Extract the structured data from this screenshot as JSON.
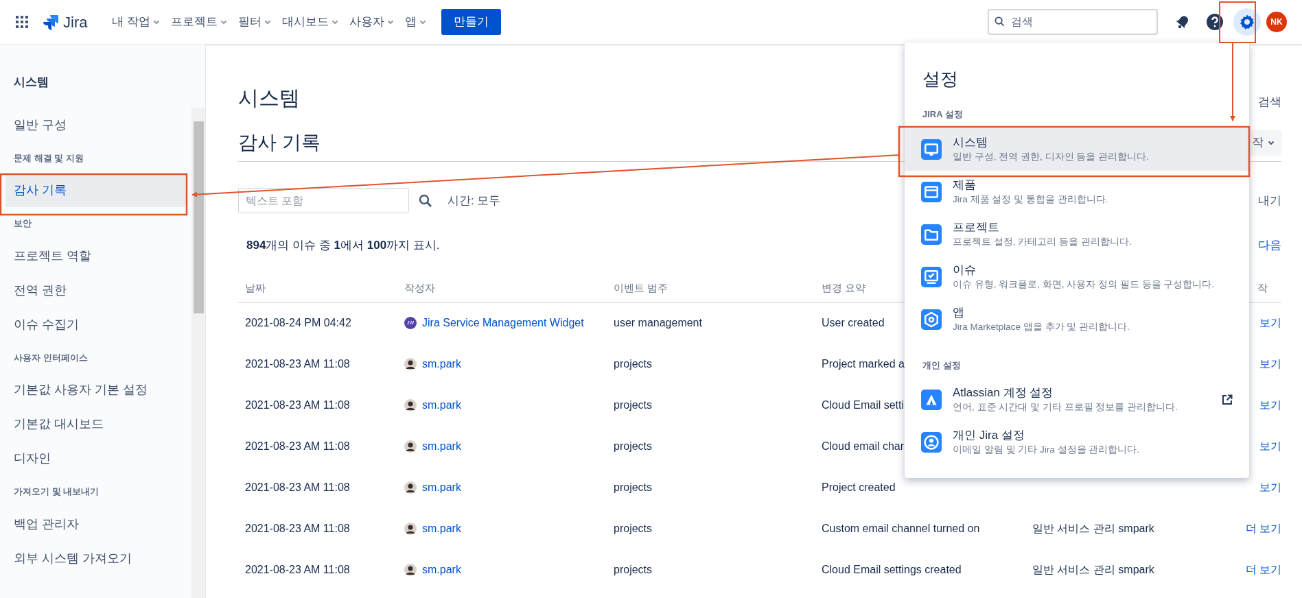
{
  "topbar": {
    "app_name": "Jira",
    "nav": [
      "내 작업",
      "프로젝트",
      "필터",
      "대시보드",
      "사용자",
      "앱"
    ],
    "create_button": "만들기",
    "search": {
      "placeholder": "검색"
    },
    "avatar": "NK"
  },
  "sidebar": {
    "title": "시스템",
    "items": [
      {
        "kind": "link",
        "label": "일반 구성",
        "selected": false
      },
      {
        "kind": "section",
        "label": "문제 해결 및 지원"
      },
      {
        "kind": "link",
        "label": "감사 기록",
        "selected": true
      },
      {
        "kind": "section",
        "label": "보안"
      },
      {
        "kind": "link",
        "label": "프로젝트 역할",
        "selected": false
      },
      {
        "kind": "link",
        "label": "전역 권한",
        "selected": false
      },
      {
        "kind": "link",
        "label": "이슈 수집기",
        "selected": false
      },
      {
        "kind": "section",
        "label": "사용자 인터페이스"
      },
      {
        "kind": "link",
        "label": "기본값 사용자 기본 설정",
        "selected": false
      },
      {
        "kind": "link",
        "label": "기본값 대시보드",
        "selected": false
      },
      {
        "kind": "link",
        "label": "디자인",
        "selected": false
      },
      {
        "kind": "section",
        "label": "가져오기 및 내보내기"
      },
      {
        "kind": "link",
        "label": "백업 관리자",
        "selected": false
      },
      {
        "kind": "link",
        "label": "외부 시스템 가져오기",
        "selected": false
      }
    ]
  },
  "main": {
    "title": "시스템",
    "subtitle": "감사 기록",
    "search_link": "검색",
    "action_button": "작",
    "filter": {
      "placeholder": "텍스트 포함",
      "time": "시간: 모두"
    },
    "export_link": "내기",
    "summary": "**894**개의 이슈 중 **1**에서 **100**까지 표시.",
    "next_link": "다음",
    "table": {
      "columns": [
        "날짜",
        "작성자",
        "이벤트 범주",
        "변경 요약"
      ],
      "column_6": "작",
      "rows": [
        {
          "date": "2021-08-24 PM 04:42",
          "author": {
            "kind": "initials",
            "initials": "JW",
            "name": "Jira Service Management Widget"
          },
          "category": "user management",
          "summary": "User created",
          "column_6": "보기"
        },
        {
          "date": "2021-08-23 AM 11:08",
          "author": {
            "kind": "photo",
            "name": "sm.park"
          },
          "category": "projects",
          "summary": "Project marked a",
          "column_6": "보기"
        },
        {
          "date": "2021-08-23 AM 11:08",
          "author": {
            "kind": "photo",
            "name": "sm.park"
          },
          "category": "projects",
          "summary": "Cloud Email setti",
          "column_6": "보기"
        },
        {
          "date": "2021-08-23 AM 11:08",
          "author": {
            "kind": "photo",
            "name": "sm.park"
          },
          "category": "projects",
          "summary": "Cloud email char",
          "column_6": "보기"
        },
        {
          "date": "2021-08-23 AM 11:08",
          "author": {
            "kind": "photo",
            "name": "sm.park"
          },
          "category": "projects",
          "summary": "Project created",
          "column_6": "보기"
        },
        {
          "date": "2021-08-23 AM 11:08",
          "author": {
            "kind": "photo",
            "name": "sm.park"
          },
          "category": "projects",
          "summary": "Custom email channel turned on",
          "column_5": "일반 서비스 관리 smpark",
          "column_6": "더 보기"
        },
        {
          "date": "2021-08-23 AM 11:08",
          "author": {
            "kind": "photo",
            "name": "sm.park"
          },
          "category": "projects",
          "summary": "Cloud Email settings created",
          "column_5": "일반 서비스 관리 smpark",
          "column_6": "더 보기"
        }
      ]
    }
  },
  "settings_menu": {
    "title": "설정",
    "sections": [
      {
        "heading": "JIRA 설정",
        "items": [
          {
            "kind": "monitor",
            "title": "시스템",
            "description": "일반 구성, 전역 권한, 디자인 등을 관리합니다.",
            "selected": true,
            "external": false
          },
          {
            "kind": "window",
            "title": "제품",
            "description": "Jira 제품 설정 및 통합을 관리합니다.",
            "selected": false,
            "external": false
          },
          {
            "kind": "folder",
            "title": "프로젝트",
            "description": "프로젝트 설정, 카테고리 등을 관리합니다.",
            "selected": false,
            "external": false
          },
          {
            "kind": "screen",
            "title": "이슈",
            "description": "이슈 유형, 워크플로, 화면, 사용자 정의 필드 등을 구성합니다.",
            "selected": false,
            "external": false
          },
          {
            "kind": "hexagon",
            "title": "앱",
            "description": "Jira Marketplace 앱을 추가 및 관리합니다.",
            "selected": false,
            "external": false
          }
        ]
      },
      {
        "heading": "개인 설정",
        "items": [
          {
            "kind": "atlassian",
            "title": "Atlassian 계정 설정",
            "description": "언어, 표준 시간대 및 기타 프로필 정보를 관리합니다.",
            "selected": false,
            "external": true
          },
          {
            "kind": "person",
            "title": "개인 Jira 설정",
            "description": "이메일 알림 및 기타 Jira 설정을 관리합니다.",
            "selected": false,
            "external": false
          }
        ]
      }
    ]
  }
}
